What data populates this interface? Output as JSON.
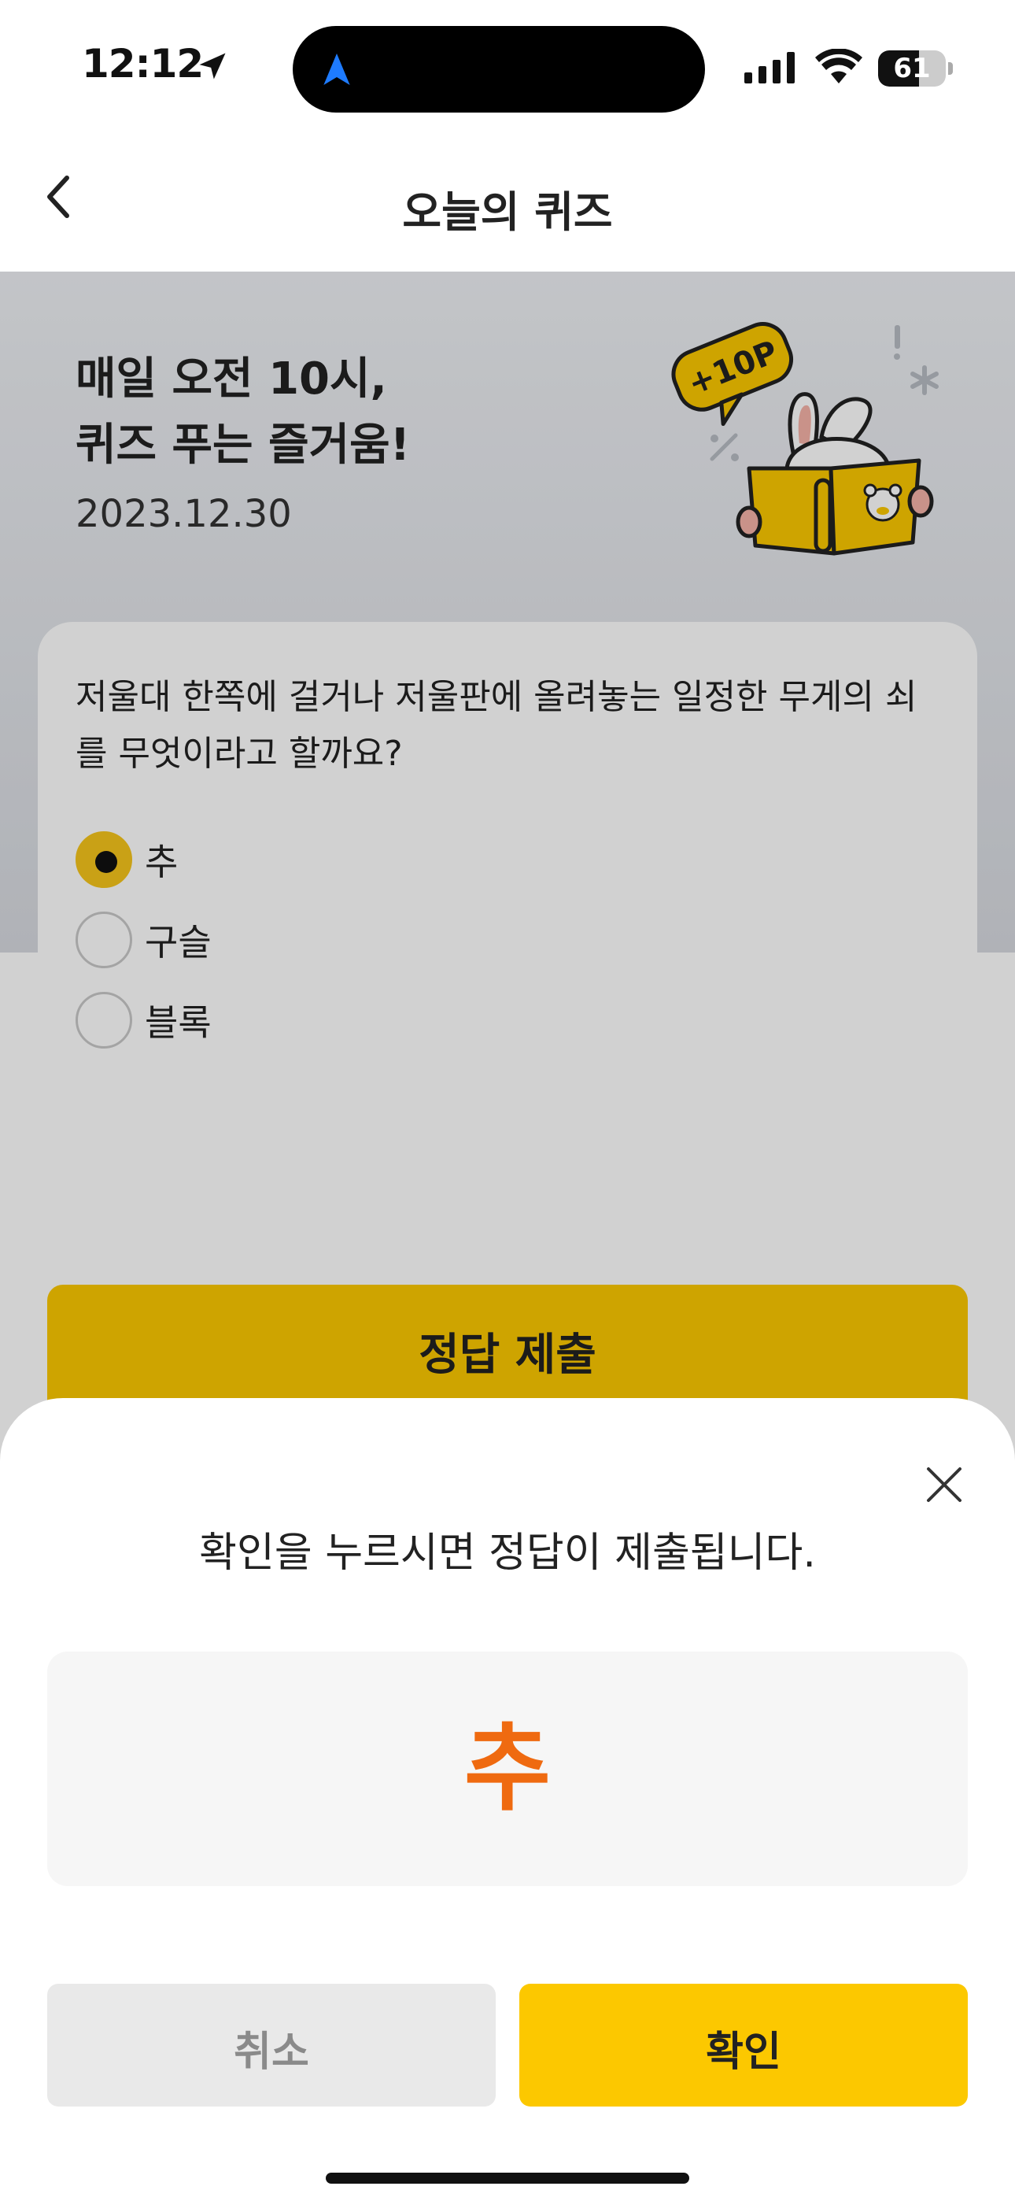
{
  "status_bar": {
    "time": "12:12",
    "battery": "61",
    "battery_level": 0.61
  },
  "nav": {
    "title": "오늘의 퀴즈"
  },
  "hero": {
    "title_line1": "매일 오전 10시,",
    "title_line2": "퀴즈 푸는 즐거움!",
    "date": "2023.12.30",
    "badge": "+10P"
  },
  "quiz": {
    "question": "저울대 한쪽에 걸거나 저울판에 올려놓는 일정한 무게의 쇠를 무엇이라고 할까요?",
    "options": [
      {
        "label": "추",
        "selected": true
      },
      {
        "label": "구슬",
        "selected": false
      },
      {
        "label": "블록",
        "selected": false
      }
    ],
    "submit_label": "정답 제출"
  },
  "sheet": {
    "message": "확인을 누르시면 정답이 제출됩니다.",
    "answer": "추",
    "cancel_label": "취소",
    "confirm_label": "확인"
  },
  "colors": {
    "accent_yellow": "#fcc800",
    "answer_orange": "#ef6a10",
    "radio_selected": "#f6c51b"
  }
}
